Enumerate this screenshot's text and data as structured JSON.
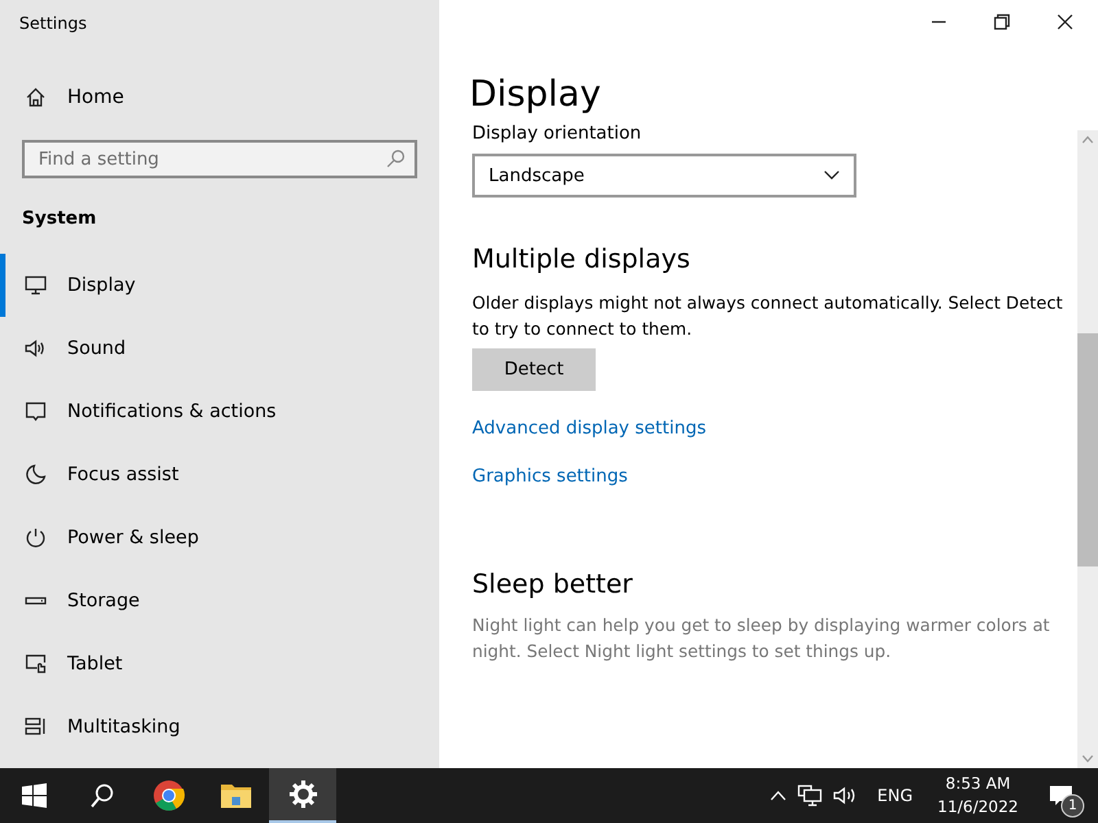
{
  "window": {
    "title": "Settings"
  },
  "sidebar": {
    "home": "Home",
    "search": {
      "placeholder": "Find a setting"
    },
    "section": "System",
    "items": [
      {
        "label": "Display",
        "selected": true
      },
      {
        "label": "Sound",
        "selected": false
      },
      {
        "label": "Notifications & actions",
        "selected": false
      },
      {
        "label": "Focus assist",
        "selected": false
      },
      {
        "label": "Power & sleep",
        "selected": false
      },
      {
        "label": "Storage",
        "selected": false
      },
      {
        "label": "Tablet",
        "selected": false
      },
      {
        "label": "Multitasking",
        "selected": false
      }
    ]
  },
  "main": {
    "title": "Display",
    "orientation": {
      "label": "Display orientation",
      "value": "Landscape"
    },
    "multiple_displays": {
      "heading": "Multiple displays",
      "text": "Older displays might not always connect automatically. Select Detect to try to connect to them.",
      "button": "Detect"
    },
    "links": [
      "Advanced display settings",
      "Graphics settings"
    ],
    "sleep_better": {
      "heading": "Sleep better",
      "text": "Night light can help you get to sleep by displaying warmer colors at night. Select Night light settings to set things up."
    }
  },
  "taskbar": {
    "apps": [
      {
        "selected": false
      },
      {
        "selected": false
      },
      {
        "selected": false
      },
      {
        "selected": true
      }
    ],
    "language": "ENG",
    "time": "8:53 AM",
    "date": "11/6/2022",
    "notifications": "1"
  }
}
